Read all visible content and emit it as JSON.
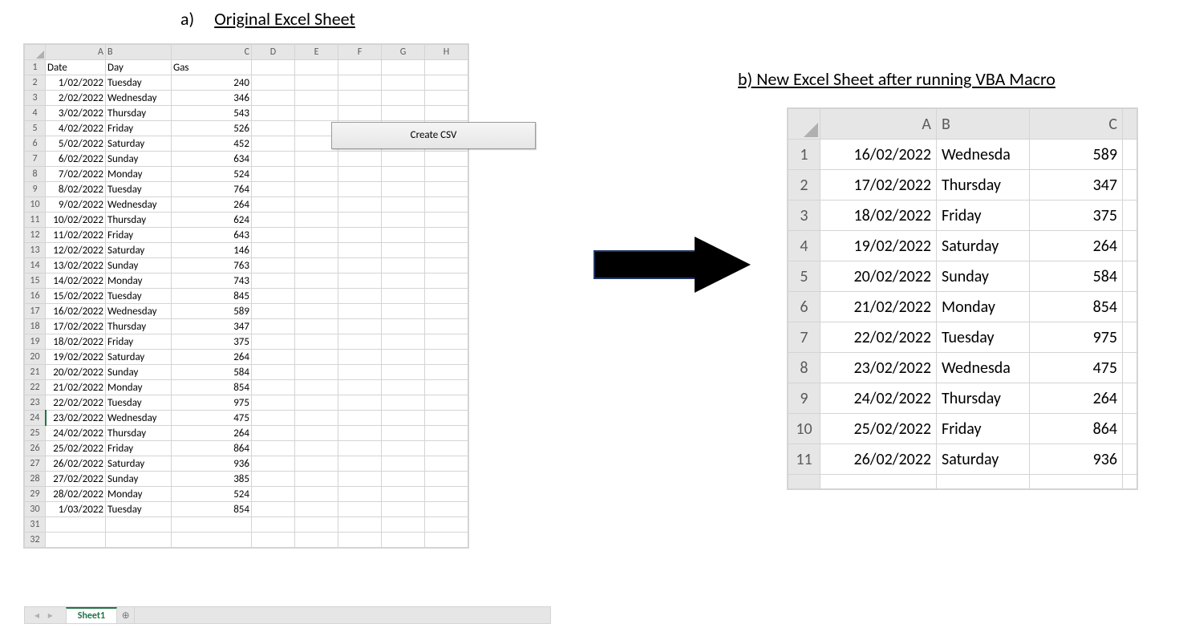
{
  "captions": {
    "a_bullet": "a)",
    "a_text": "Original Excel Sheet",
    "b_text": "b) New Excel Sheet after running VBA Macro"
  },
  "left": {
    "columns": [
      "A",
      "B",
      "C",
      "D",
      "E",
      "F",
      "G",
      "H"
    ],
    "headers": {
      "A": "Date",
      "B": "Day",
      "C": "Gas"
    },
    "rows": [
      {
        "A": "1/02/2022",
        "B": "Tuesday",
        "C": "240"
      },
      {
        "A": "2/02/2022",
        "B": "Wednesday",
        "C": "346"
      },
      {
        "A": "3/02/2022",
        "B": "Thursday",
        "C": "543"
      },
      {
        "A": "4/02/2022",
        "B": "Friday",
        "C": "526"
      },
      {
        "A": "5/02/2022",
        "B": "Saturday",
        "C": "452"
      },
      {
        "A": "6/02/2022",
        "B": "Sunday",
        "C": "634"
      },
      {
        "A": "7/02/2022",
        "B": "Monday",
        "C": "524"
      },
      {
        "A": "8/02/2022",
        "B": "Tuesday",
        "C": "764"
      },
      {
        "A": "9/02/2022",
        "B": "Wednesday",
        "C": "264"
      },
      {
        "A": "10/02/2022",
        "B": "Thursday",
        "C": "624"
      },
      {
        "A": "11/02/2022",
        "B": "Friday",
        "C": "643"
      },
      {
        "A": "12/02/2022",
        "B": "Saturday",
        "C": "146"
      },
      {
        "A": "13/02/2022",
        "B": "Sunday",
        "C": "763"
      },
      {
        "A": "14/02/2022",
        "B": "Monday",
        "C": "743"
      },
      {
        "A": "15/02/2022",
        "B": "Tuesday",
        "C": "845"
      },
      {
        "A": "16/02/2022",
        "B": "Wednesday",
        "C": "589"
      },
      {
        "A": "17/02/2022",
        "B": "Thursday",
        "C": "347"
      },
      {
        "A": "18/02/2022",
        "B": "Friday",
        "C": "375"
      },
      {
        "A": "19/02/2022",
        "B": "Saturday",
        "C": "264"
      },
      {
        "A": "20/02/2022",
        "B": "Sunday",
        "C": "584"
      },
      {
        "A": "21/02/2022",
        "B": "Monday",
        "C": "854"
      },
      {
        "A": "22/02/2022",
        "B": "Tuesday",
        "C": "975"
      },
      {
        "A": "23/02/2022",
        "B": "Wednesday",
        "C": "475"
      },
      {
        "A": "24/02/2022",
        "B": "Thursday",
        "C": "264"
      },
      {
        "A": "25/02/2022",
        "B": "Friday",
        "C": "864"
      },
      {
        "A": "26/02/2022",
        "B": "Saturday",
        "C": "936"
      },
      {
        "A": "27/02/2022",
        "B": "Sunday",
        "C": "385"
      },
      {
        "A": "28/02/2022",
        "B": "Monday",
        "C": "524"
      },
      {
        "A": "1/03/2022",
        "B": "Tuesday",
        "C": "854"
      }
    ],
    "empty_rows": [
      "31",
      "32"
    ],
    "selected_row": "24",
    "tab": "Sheet1",
    "button": "Create CSV"
  },
  "right": {
    "columns": [
      "A",
      "B",
      "C"
    ],
    "rows": [
      {
        "A": "16/02/2022",
        "B": "Wednesda",
        "C": "589"
      },
      {
        "A": "17/02/2022",
        "B": "Thursday",
        "C": "347"
      },
      {
        "A": "18/02/2022",
        "B": "Friday",
        "C": "375"
      },
      {
        "A": "19/02/2022",
        "B": "Saturday",
        "C": "264"
      },
      {
        "A": "20/02/2022",
        "B": "Sunday",
        "C": "584"
      },
      {
        "A": "21/02/2022",
        "B": "Monday",
        "C": "854"
      },
      {
        "A": "22/02/2022",
        "B": "Tuesday",
        "C": "975"
      },
      {
        "A": "23/02/2022",
        "B": "Wednesda",
        "C": "475"
      },
      {
        "A": "24/02/2022",
        "B": "Thursday",
        "C": "264"
      },
      {
        "A": "25/02/2022",
        "B": "Friday",
        "C": "864"
      },
      {
        "A": "26/02/2022",
        "B": "Saturday",
        "C": "936"
      }
    ]
  }
}
